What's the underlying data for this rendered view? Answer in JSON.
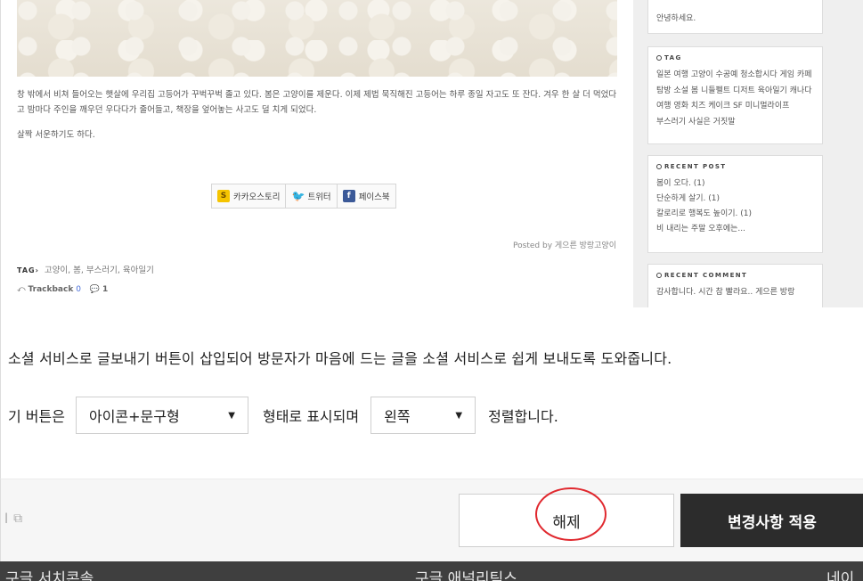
{
  "blog": {
    "post_paragraph_1": "창 밖에서 비쳐 들어오는 햇살에 우리집 고등어가 꾸벅꾸벅 졸고 있다. 봄은 고양이를 제운다. 이제 제법 묵직해진 고등어는 하루 종일 자고도 또 잔다. 겨우 한 살 더 먹었다고 밤마다 주인을 깨우던 우다다가 줄어들고, 책장을 엎어놓는 사고도 덜 치게 되었다.",
    "post_paragraph_2": "살짝 서운하기도 하다.",
    "share": {
      "kakao": "카카오스토리",
      "twitter": "트위터",
      "facebook": "페이스북"
    },
    "posted_by": "Posted by 게으른 방랑고양이",
    "tag_label": "TAG›",
    "tags": "고양이, 봄, 부스러기, 육아일기",
    "trackback_label": "Trackback",
    "trackback_count": "0",
    "comment_count": "1"
  },
  "sidebar": {
    "greeting": "안녕하세요.",
    "tag_title": "TAG",
    "tag_cloud": "일본 여행 고양이 수공예 청소합시다 게임 카페 탐방 소설 봄 니들펠트 디저트 육아일기 캐나다 여행 영화 치즈 케이크 SF 미니멀라이프 부스러기 사실은 거짓말",
    "recent_post_title": "RECENT POST",
    "recent_posts": [
      "봄이 오다. (1)",
      "단순하게 살기. (1)",
      "칼로리로 행복도 높이기. (1)",
      "비 내리는 주말 오후에는..."
    ],
    "recent_comment_title": "RECENT COMMENT",
    "recent_comment": "감사합니다. 시간 참 빨라요.. 게으른 방랑"
  },
  "settings": {
    "description": "소셜 서비스로 글보내기 버튼이 삽입되어 방문자가 마음에 드는 글을 소셜 서비스로 쉽게 보내도록 도와줍니다.",
    "row_prefix": "기 버튼은",
    "style_select": "아이콘+문구형",
    "row_middle": "형태로 표시되며",
    "align_select": "왼쪽",
    "row_suffix": "정렬합니다."
  },
  "footer": {
    "preview_label": "l",
    "release_button": "해제",
    "apply_button": "변경사항 적용"
  },
  "bottom_strip": {
    "item_1": "구글 서치콘솔",
    "item_2": "구글 애널리틱스",
    "item_3": "네이"
  },
  "colors": {
    "annotation_circle": "#e0282e",
    "apply_button_bg": "#2c2c2c",
    "link_blue": "#4a6fd8"
  }
}
